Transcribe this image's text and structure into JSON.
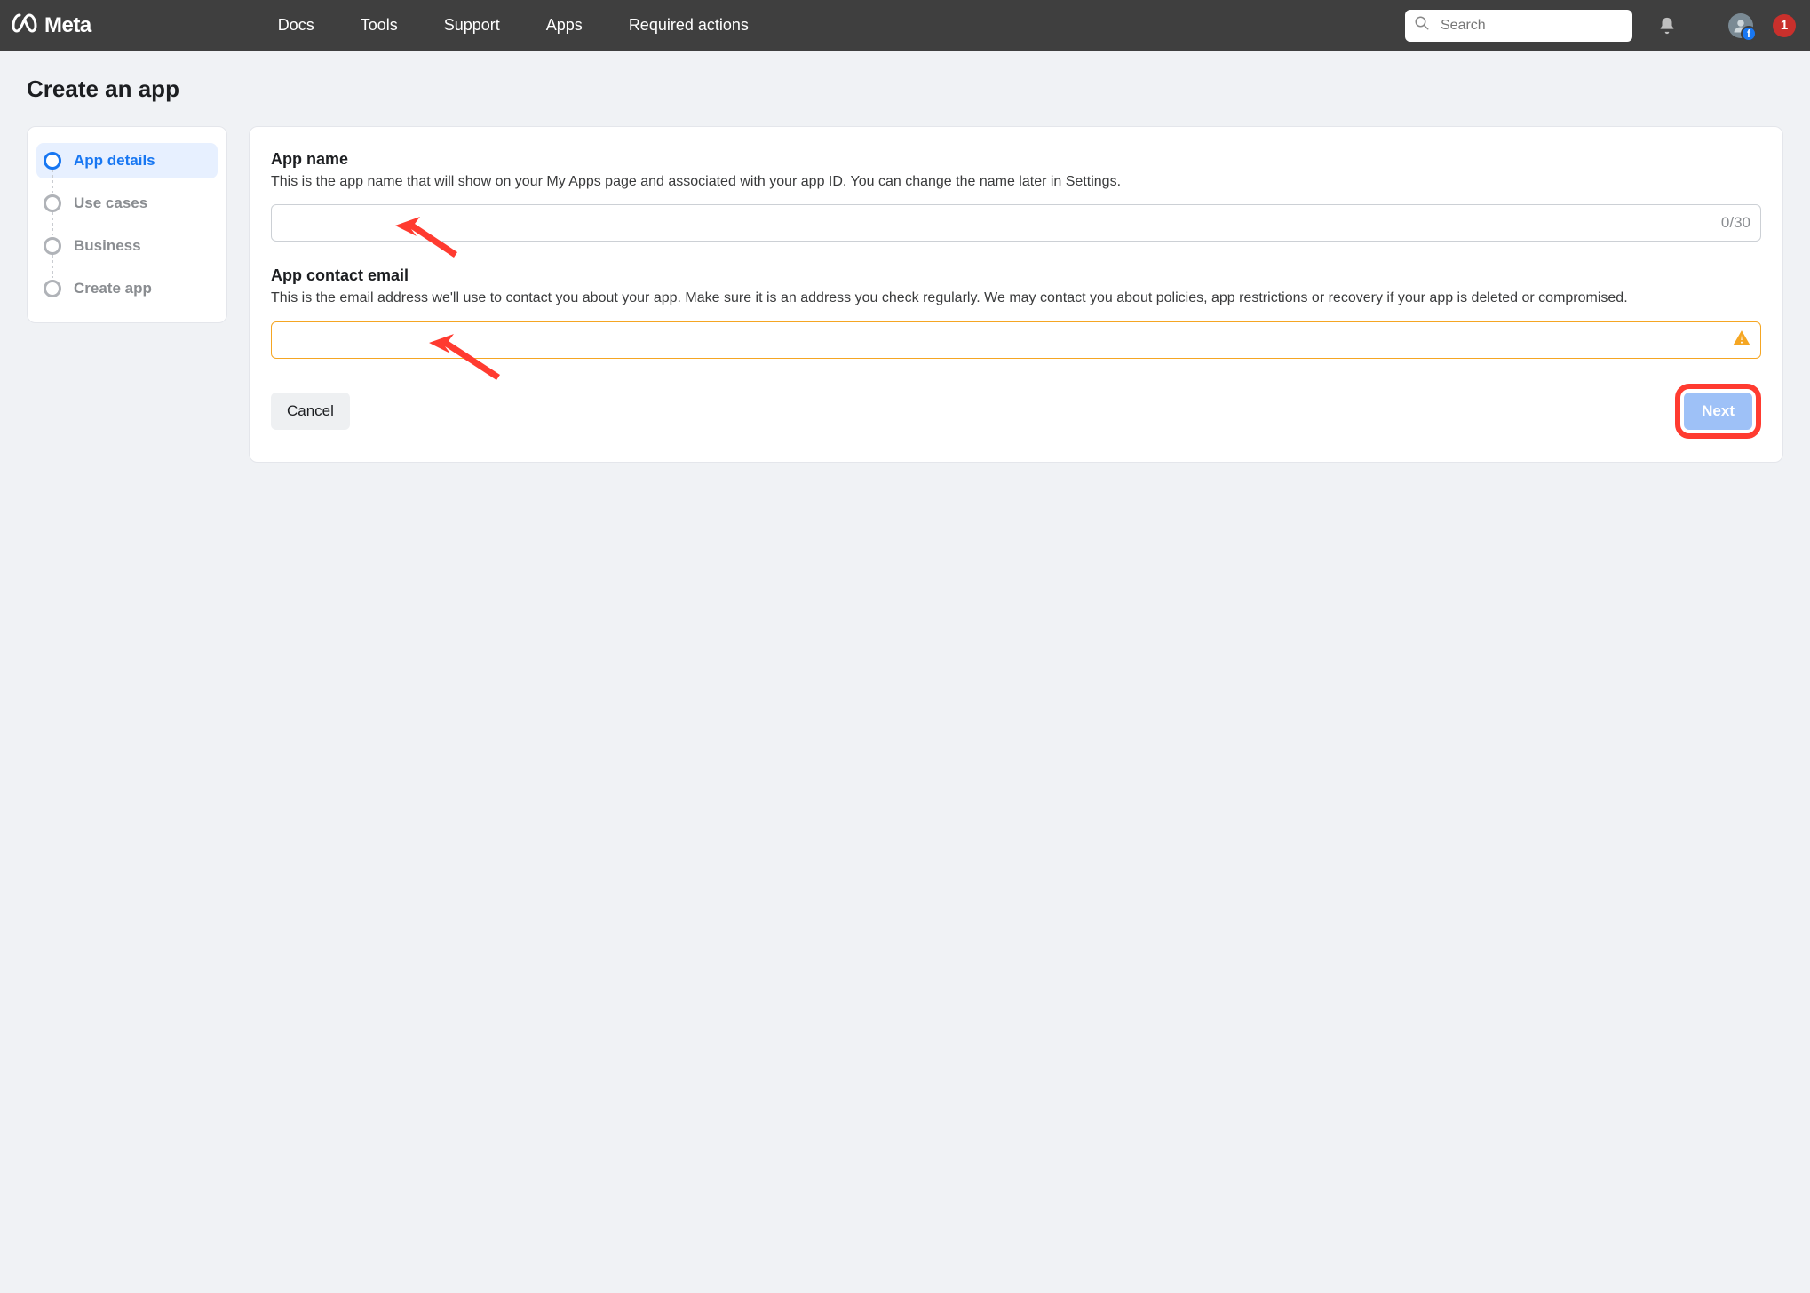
{
  "brand": {
    "name": "Meta"
  },
  "nav": {
    "items": [
      "Docs",
      "Tools",
      "Support",
      "Apps",
      "Required actions"
    ]
  },
  "search": {
    "placeholder": "Search"
  },
  "notif": {
    "count": "1"
  },
  "page": {
    "title": "Create an app"
  },
  "sidebar": {
    "steps": [
      {
        "label": "App details",
        "active": true
      },
      {
        "label": "Use cases",
        "active": false
      },
      {
        "label": "Business",
        "active": false
      },
      {
        "label": "Create app",
        "active": false
      }
    ]
  },
  "form": {
    "app_name": {
      "label": "App name",
      "desc": "This is the app name that will show on your My Apps page and associated with your app ID. You can change the name later in Settings.",
      "value": "",
      "counter": "0/30"
    },
    "contact_email": {
      "label": "App contact email",
      "desc": "This is the email address we'll use to contact you about your app. Make sure it is an address you check regularly. We may contact you about policies, app restrictions or recovery if your app is deleted or compromised.",
      "value": ""
    },
    "cancel_label": "Cancel",
    "next_label": "Next"
  }
}
